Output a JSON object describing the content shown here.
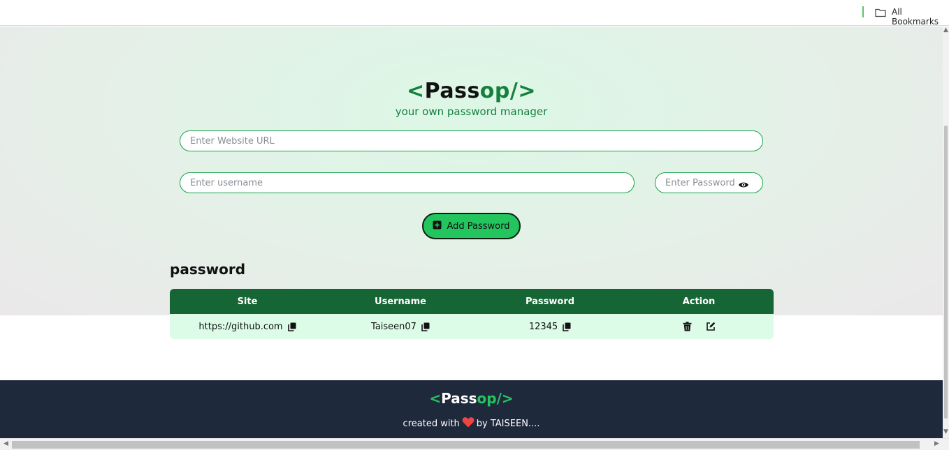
{
  "bookmarks_bar": {
    "all_bookmarks": "All Bookmarks",
    "folder_icon": "folder-icon"
  },
  "header": {
    "logo_open": "<",
    "logo_pass": "Pass",
    "logo_op": "op/",
    "logo_close": ">",
    "subtitle": "your own password manager"
  },
  "form": {
    "url_placeholder": "Enter Website URL",
    "username_placeholder": "Enter username",
    "password_placeholder": "Enter Password",
    "eye_icon": "eye-icon",
    "add_button_label": "Add Password",
    "add_icon": "plus-square-icon"
  },
  "passwords": {
    "title": "password",
    "columns": [
      "Site",
      "Username",
      "Password",
      "Action"
    ],
    "rows": [
      {
        "site": "https://github.com",
        "username": "Taiseen07",
        "password": "12345"
      }
    ],
    "copy_icon": "copy-icon",
    "delete_icon": "trash-icon",
    "edit_icon": "edit-icon"
  },
  "footer": {
    "logo_open": "<",
    "logo_pass": "Pass",
    "logo_op": "op/",
    "logo_close": ">",
    "credit_prefix": "created with",
    "credit_suffix": "by TAISEEN....",
    "heart_icon": "heart-icon"
  },
  "colors": {
    "brand_green": "#15803d",
    "button_green": "#22c55e",
    "table_header": "#166534",
    "table_row": "#dcfce7",
    "footer_bg": "#1e293b",
    "heart": "#ef4444"
  }
}
